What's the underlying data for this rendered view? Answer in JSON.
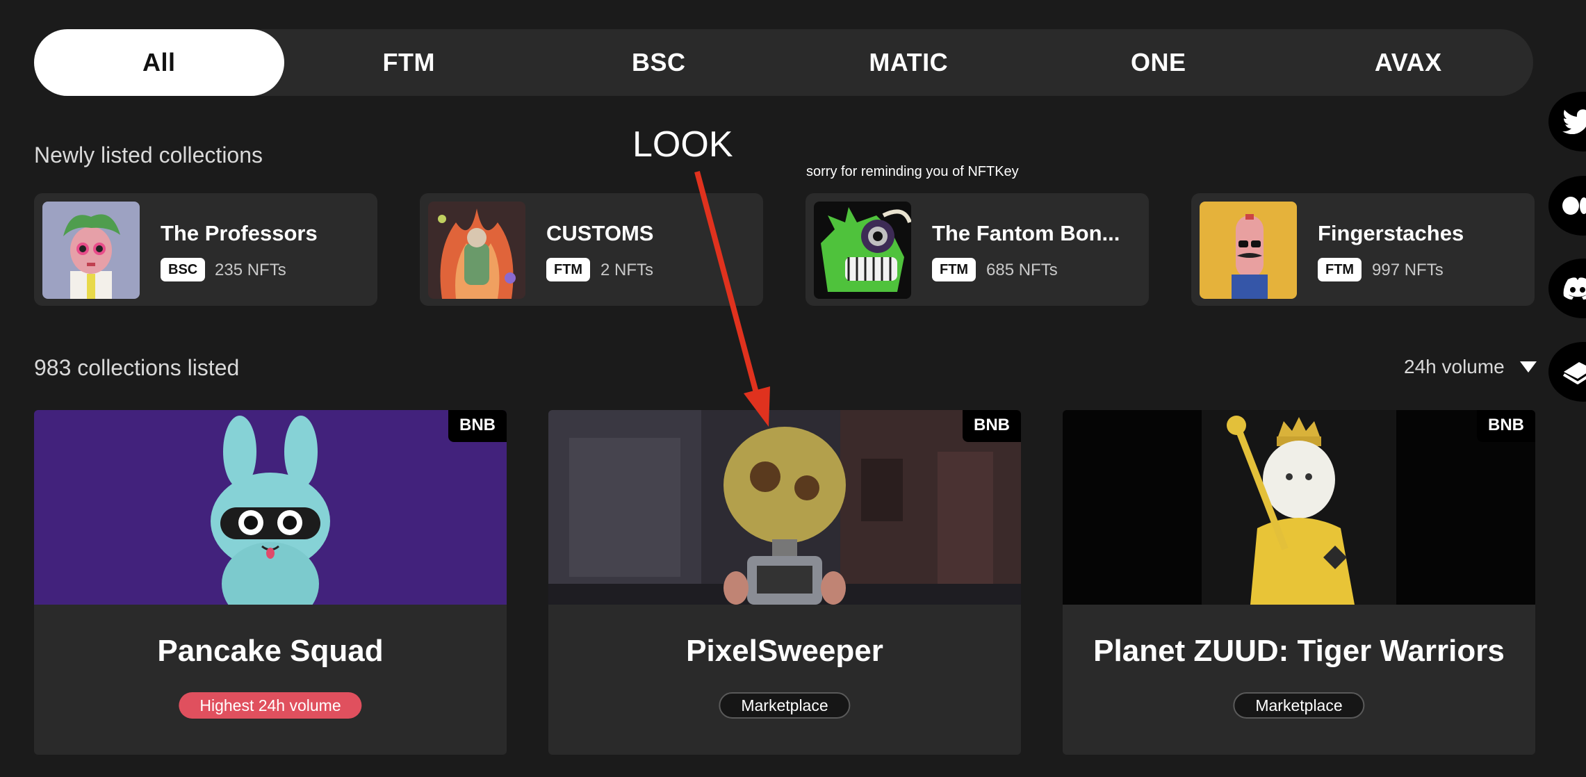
{
  "chain_tabs": [
    "All",
    "FTM",
    "BSC",
    "MATIC",
    "ONE",
    "AVAX"
  ],
  "newly_listed": {
    "heading": "Newly listed collections",
    "items": [
      {
        "name": "The Professors",
        "chain": "BSC",
        "count": "235 NFTs"
      },
      {
        "name": "CUSTOMS",
        "chain": "FTM",
        "count": "2 NFTs"
      },
      {
        "name": "The Fantom Bon...",
        "chain": "FTM",
        "count": "685 NFTs"
      },
      {
        "name": "Fingerstaches",
        "chain": "FTM",
        "count": "997 NFTs"
      }
    ]
  },
  "annotations": {
    "look": "LOOK",
    "note": "sorry for reminding you of NFTKey",
    "arrow_color": "#e0321e"
  },
  "collections": {
    "count_label": "983 collections listed",
    "sort_label": "24h volume",
    "cards": [
      {
        "title": "Pancake Squad",
        "chain": "BNB",
        "tag": "Highest 24h volume"
      },
      {
        "title": "PixelSweeper",
        "chain": "BNB",
        "tag": "Marketplace"
      },
      {
        "title": "Planet ZUUD: Tiger Warriors",
        "chain": "BNB",
        "tag": "Marketplace"
      }
    ]
  },
  "social_icons": [
    "twitter-icon",
    "medium-icon",
    "discord-icon",
    "docs-book-icon"
  ],
  "colors": {
    "background": "#1b1b1b",
    "card": "#2a2a2a",
    "active_tab": "#ffffff",
    "highlight_tag": "#e0505e"
  }
}
